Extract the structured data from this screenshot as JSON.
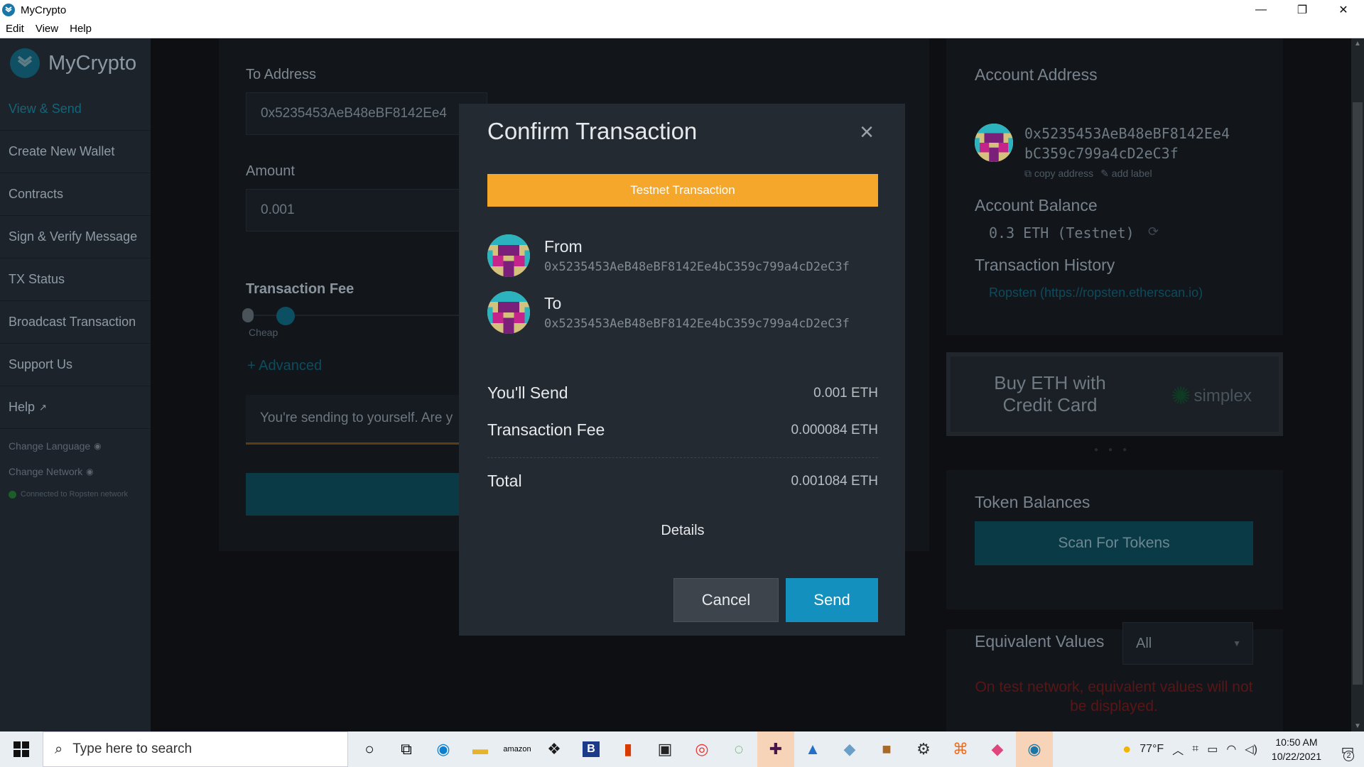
{
  "window": {
    "title": "MyCrypto",
    "menu": [
      "Edit",
      "View",
      "Help"
    ],
    "controls": {
      "minimize": "—",
      "restore": "❐",
      "close": "✕"
    }
  },
  "sidebar": {
    "brand": "MyCrypto",
    "items": [
      {
        "label": "View & Send",
        "active": true
      },
      {
        "label": "Create New Wallet"
      },
      {
        "label": "Contracts"
      },
      {
        "label": "Sign & Verify Message"
      },
      {
        "label": "TX Status"
      },
      {
        "label": "Broadcast Transaction"
      },
      {
        "label": "Support Us"
      },
      {
        "label": "Help"
      }
    ],
    "change_language": "Change Language",
    "change_network": "Change Network",
    "network_status": "Connected to Ropsten network"
  },
  "form": {
    "to_address_label": "To Address",
    "to_address_value": "0x5235453AeB48eBF8142Ee4",
    "amount_label": "Amount",
    "amount_value": "0.001",
    "fee_label": "Transaction Fee",
    "fee_slider_label": "Cheap",
    "advanced_link": "+ Advanced",
    "self_send_warning": "You're sending to yourself. Are y"
  },
  "account": {
    "address_heading": "Account Address",
    "address_line1": "0x5235453AeB48eBF8142Ee4",
    "address_line2": "bC359c799a4cD2eC3f",
    "copy_address": "copy address",
    "add_label": "add label",
    "balance_heading": "Account Balance",
    "balance_value": "0.3 ETH (Testnet)",
    "history_heading": "Transaction History",
    "history_link": "Ropsten (https://ropsten.etherscan.io)",
    "buy_eth_text": "Buy ETH with Credit Card",
    "simplex_logo": "simplex",
    "carousel_dots": 3,
    "token_heading": "Token Balances",
    "scan_tokens": "Scan For Tokens",
    "equiv_heading": "Equivalent Values",
    "equiv_select": "All",
    "equiv_warning": "On test network, equivalent values will not be displayed."
  },
  "modal": {
    "title": "Confirm Transaction",
    "close_icon": "close-icon",
    "testnet_badge": "Testnet Transaction",
    "from_label": "From",
    "from_address": "0x5235453AeB48eBF8142Ee4bC359c799a4cD2eC3f",
    "to_label": "To",
    "to_address": "0x5235453AeB48eBF8142Ee4bC359c799a4cD2eC3f",
    "send_label": "You'll Send",
    "send_value": "0.001 ETH",
    "fee_label": "Transaction Fee",
    "fee_value": "0.000084 ETH",
    "total_label": "Total",
    "total_value": "0.001084 ETH",
    "details": "Details",
    "cancel": "Cancel",
    "send": "Send"
  },
  "taskbar": {
    "search_placeholder": "Type here to search",
    "temperature": "77°F",
    "time": "10:50 AM",
    "date": "10/22/2021",
    "notifications": "2"
  },
  "colors": {
    "accent": "#1390bd",
    "testnet": "#f4a72a",
    "modal_bg": "#242a31",
    "sidebar_bg": "#1d232a",
    "warning_red": "#5a1515"
  }
}
